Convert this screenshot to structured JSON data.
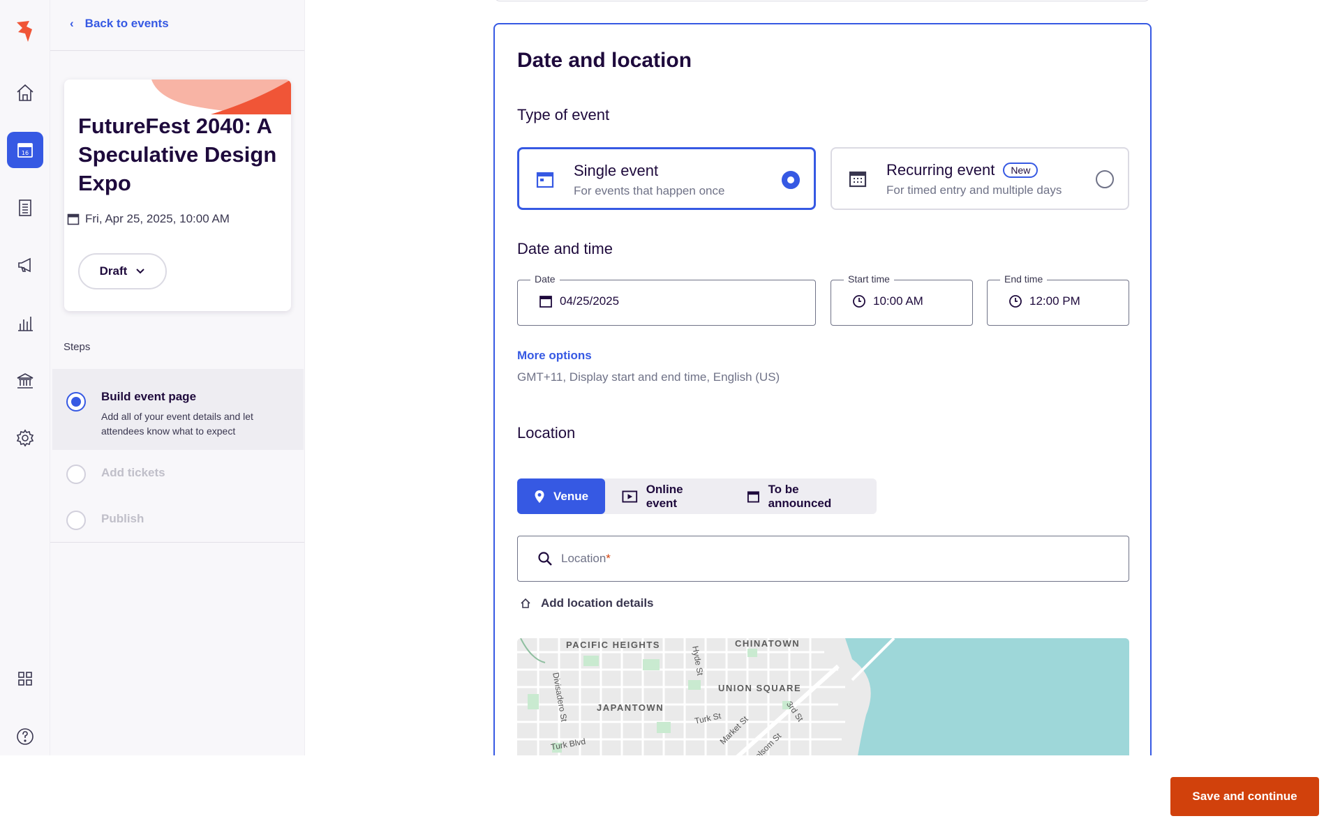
{
  "nav": {
    "back_label": "Back to events",
    "rail": [
      "logo-icon",
      "home-icon",
      "calendar-icon",
      "orders-icon",
      "megaphone-icon",
      "chart-icon",
      "finance-icon",
      "settings-icon",
      "apps-icon",
      "help-icon"
    ],
    "calendar_day": "16"
  },
  "event": {
    "title": "FutureFest 2040: A Speculative Design Expo",
    "date": "Fri, Apr 25, 2025, 10:00 AM",
    "status": "Draft"
  },
  "steps": {
    "label": "Steps",
    "items": [
      {
        "title": "Build event page",
        "desc": "Add all of your event details and let attendees know what to expect"
      },
      {
        "title": "Add tickets"
      },
      {
        "title": "Publish"
      }
    ]
  },
  "form": {
    "heading": "Date and location",
    "type_heading": "Type of event",
    "single": {
      "title": "Single event",
      "sub": "For events that happen once"
    },
    "recurring": {
      "title": "Recurring event",
      "badge": "New",
      "sub": "For timed entry and multiple days"
    },
    "datetime_heading": "Date and time",
    "date": {
      "label": "Date",
      "value": "04/25/2025"
    },
    "start": {
      "label": "Start time",
      "value": "10:00 AM"
    },
    "end": {
      "label": "End time",
      "value": "12:00 PM"
    },
    "more_options": "More options",
    "more_desc": "GMT+11, Display start and end time, English (US)",
    "location_heading": "Location",
    "loc_tabs": [
      "Venue",
      "Online event",
      "To be announced"
    ],
    "location_placeholder": "Location",
    "required_mark": "*",
    "add_details": "Add location details"
  },
  "map": {
    "labels": [
      "PACIFIC HEIGHTS",
      "CHINATOWN",
      "UNION SQUARE",
      "JAPANTOWN"
    ],
    "streets": [
      "Divisadero St",
      "Hyde St",
      "Turk St",
      "Market St",
      "3rd St",
      "Turk Blvd",
      "Folsom St"
    ]
  },
  "footer": {
    "save_label": "Save and continue"
  },
  "colors": {
    "accent": "#3659e3",
    "brand": "#d1410c",
    "bg_sidebar": "#f8f7fa"
  }
}
